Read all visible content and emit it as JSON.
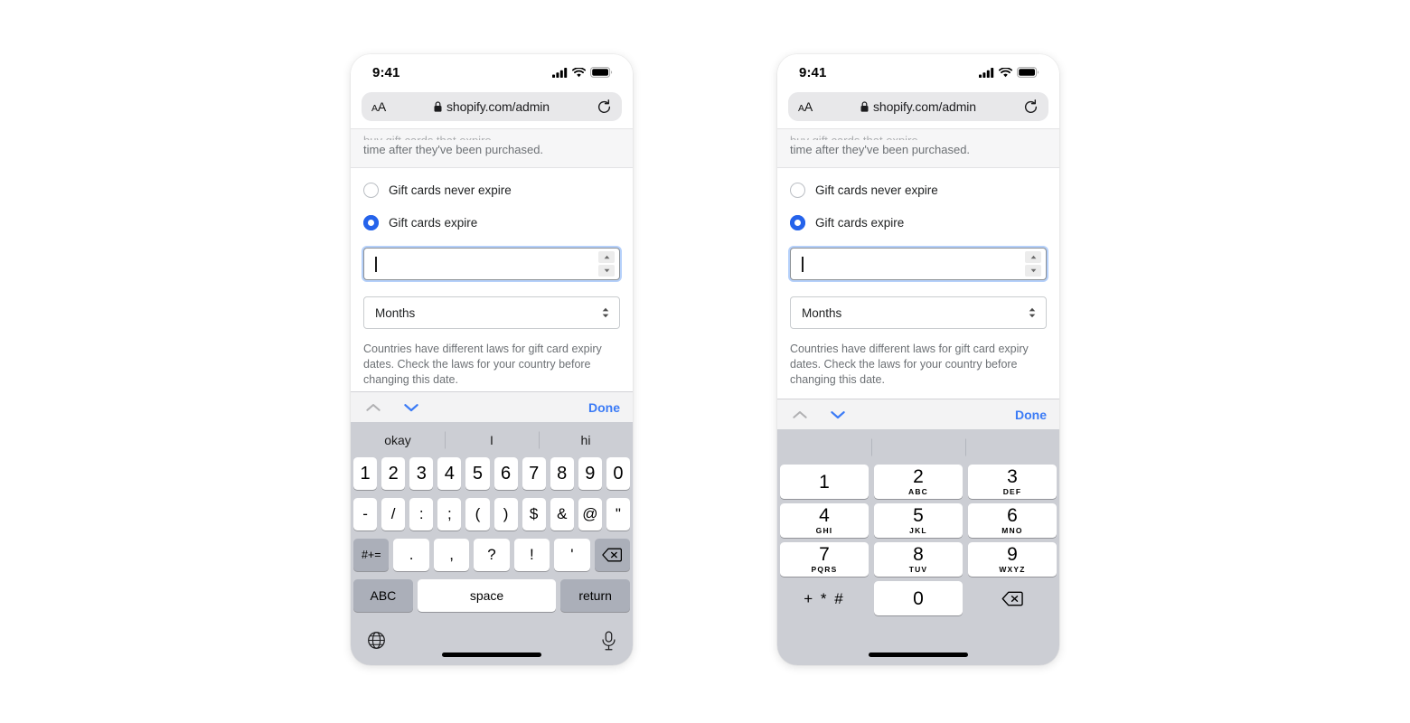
{
  "statusbar": {
    "time": "9:41",
    "icons": [
      "cell-signal",
      "wifi",
      "battery"
    ]
  },
  "browser": {
    "aa_label": "AA",
    "lock_icon": "lock-icon",
    "url": "shopify.com/admin",
    "reload_icon": "reload-icon"
  },
  "content": {
    "clipped_text": "time after they've been purchased.",
    "radio_never": "Gift cards never expire",
    "radio_expire": "Gift cards expire",
    "number_value": "",
    "unit_value": "Months",
    "helper": "Countries have different laws for gift card expiry dates. Check the laws for your country before changing this date."
  },
  "toolbar": {
    "prev_icon": "chevron-up-icon",
    "next_icon": "chevron-down-icon",
    "done_label": "Done",
    "prev_color": "#b0b0b2",
    "next_color": "#3b7bf6",
    "done_color": "#3b7bf6"
  },
  "left_keyboard": {
    "type": "symbols",
    "suggestions": [
      "okay",
      "I",
      "hi"
    ],
    "row1": [
      "1",
      "2",
      "3",
      "4",
      "5",
      "6",
      "7",
      "8",
      "9",
      "0"
    ],
    "row2": [
      "-",
      "/",
      ":",
      ";",
      "(",
      ")",
      "$",
      "&",
      "@",
      "\""
    ],
    "row3_left": "#+=",
    "row3": [
      ".",
      ",",
      "?",
      "!",
      "'"
    ],
    "row3_right": "backspace-icon",
    "row4_left": "ABC",
    "row4_space": "space",
    "row4_right": "return",
    "globe_icon": "globe-icon",
    "mic_icon": "microphone-icon"
  },
  "right_keyboard": {
    "type": "numeric",
    "suggestions": [
      "",
      "",
      ""
    ],
    "keys": [
      {
        "digit": "1",
        "letters": ""
      },
      {
        "digit": "2",
        "letters": "ABC"
      },
      {
        "digit": "3",
        "letters": "DEF"
      },
      {
        "digit": "4",
        "letters": "GHI"
      },
      {
        "digit": "5",
        "letters": "JKL"
      },
      {
        "digit": "6",
        "letters": "MNO"
      },
      {
        "digit": "7",
        "letters": "PQRS"
      },
      {
        "digit": "8",
        "letters": "TUV"
      },
      {
        "digit": "9",
        "letters": "WXYZ"
      }
    ],
    "symbols_key": "+ * #",
    "zero_key": "0",
    "backspace_icon": "backspace-icon"
  },
  "colors": {
    "accent_blue": "#2563eb",
    "link_blue": "#3b7bf6",
    "keyboard_bg": "#ccced4",
    "key_white": "#ffffff",
    "key_dark": "#abafb9",
    "page_bg": "#ffffff"
  }
}
